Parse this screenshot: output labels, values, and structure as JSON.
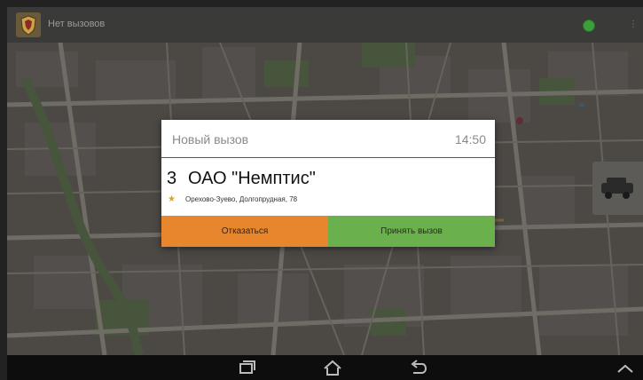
{
  "app": {
    "title": "Нет вызовов",
    "logo_icon": "shield-logo-icon",
    "status_color": "#3aa03a"
  },
  "dialog": {
    "title": "Новый вызов",
    "time": "14:50",
    "call": {
      "number": "3",
      "name": "ОАО \"Немптис\"",
      "address": "Орехово-Зуево, Долгопрудная, 78",
      "rating_icon": "star-icon"
    },
    "buttons": {
      "decline_label": "Отказаться",
      "accept_label": "Принять вызов"
    },
    "colors": {
      "decline": "#e8862d",
      "accept": "#6ab04c"
    }
  },
  "navbar": {
    "icons": [
      "recent-apps-icon",
      "home-icon",
      "back-icon",
      "chevron-up-icon"
    ]
  }
}
